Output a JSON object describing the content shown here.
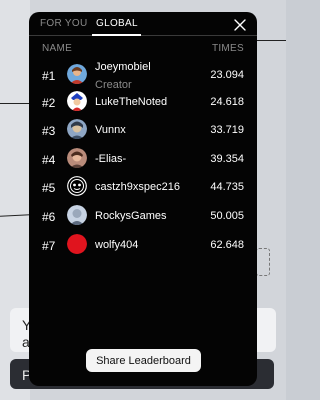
{
  "tabs": [
    {
      "label": "FOR YOU",
      "active": false
    },
    {
      "label": "GLOBAL",
      "active": true
    }
  ],
  "columns": {
    "name": "NAME",
    "times": "TIMES"
  },
  "leaderboard": [
    {
      "rank": "#1",
      "name": "Joeymobiel",
      "subtitle": "Creator",
      "time": "23.094",
      "avatar": "avatar-portrait-icon"
    },
    {
      "rank": "#2",
      "name": "LukeTheNoted",
      "subtitle": "",
      "time": "24.618",
      "avatar": "avatar-character-icon"
    },
    {
      "rank": "#3",
      "name": "Vunnx",
      "subtitle": "",
      "time": "33.719",
      "avatar": "avatar-photo-icon"
    },
    {
      "rank": "#4",
      "name": "-Elias-",
      "subtitle": "",
      "time": "39.354",
      "avatar": "avatar-portrait-icon"
    },
    {
      "rank": "#5",
      "name": "castzh9xspec216",
      "subtitle": "",
      "time": "44.735",
      "avatar": "avatar-mask-icon"
    },
    {
      "rank": "#6",
      "name": "RockysGames",
      "subtitle": "",
      "time": "50.005",
      "avatar": "avatar-photo-icon"
    },
    {
      "rank": "#7",
      "name": "wolfy404",
      "subtitle": "",
      "time": "62.648",
      "avatar": "avatar-solid-red-icon"
    }
  ],
  "share_button": "Share Leaderboard",
  "background": {
    "card1_text": "Y",
    "card1_text2": "a",
    "card2_text": "P"
  },
  "colors": {
    "modal_bg": "#040404",
    "accent_text": "#ffffff",
    "muted_text": "#8a8a8a",
    "avatar_red": "#e0141e"
  }
}
